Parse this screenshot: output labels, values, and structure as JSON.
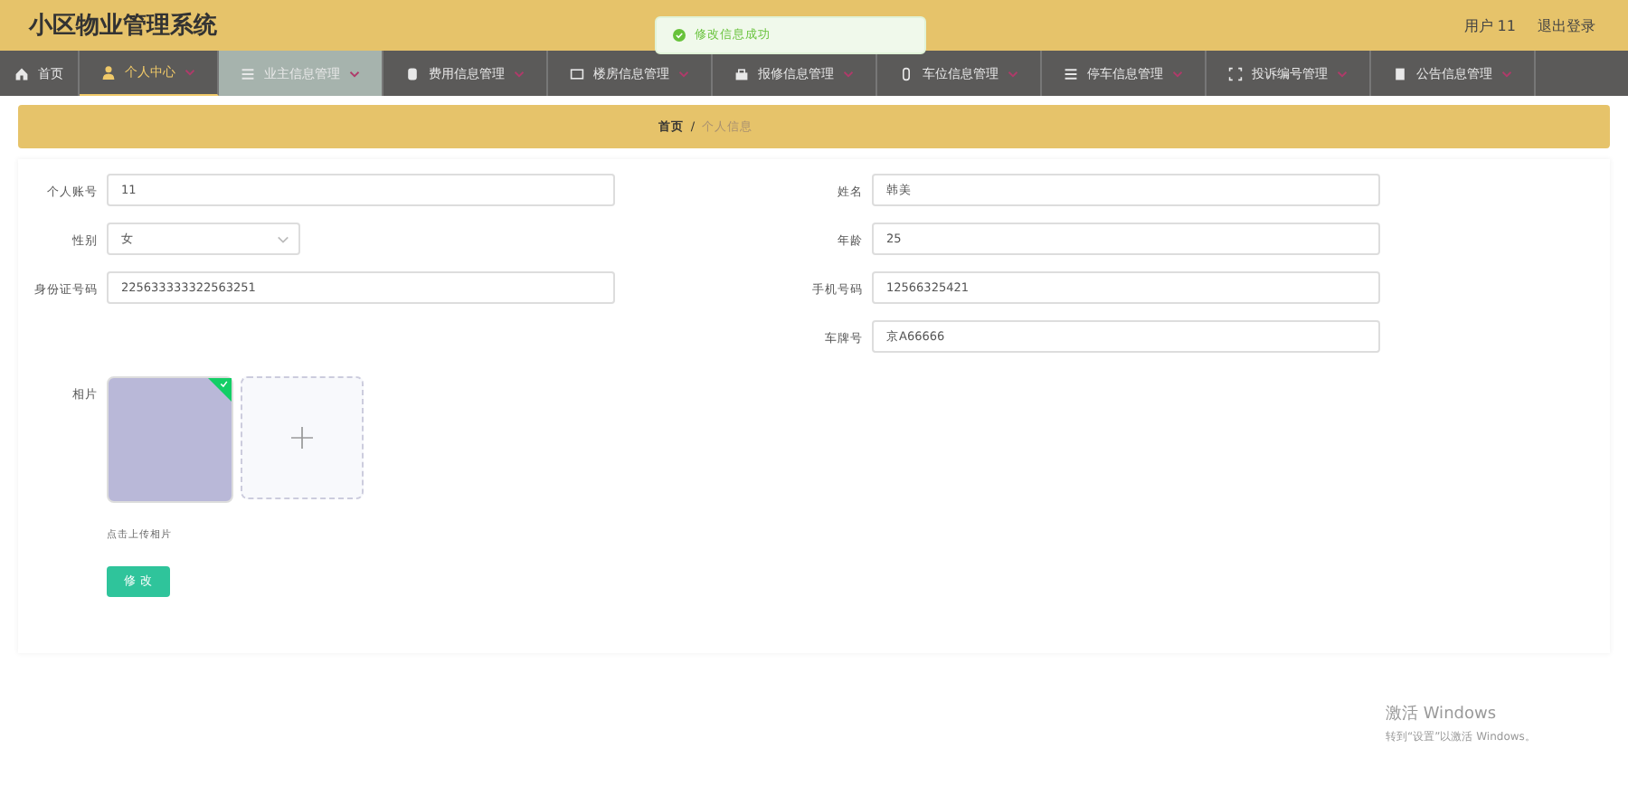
{
  "header": {
    "title": "小区物业管理系统",
    "user": "用户 11",
    "logout": "退出登录"
  },
  "toast": {
    "message": "修改信息成功"
  },
  "nav": [
    {
      "label": "首页",
      "selected": false,
      "hovered": false,
      "has_caret": false
    },
    {
      "label": "个人中心",
      "selected": true,
      "hovered": false,
      "has_caret": true
    },
    {
      "label": "业主信息管理",
      "selected": false,
      "hovered": true,
      "has_caret": true
    },
    {
      "label": "费用信息管理",
      "selected": false,
      "hovered": false,
      "has_caret": true
    },
    {
      "label": "楼房信息管理",
      "selected": false,
      "hovered": false,
      "has_caret": true
    },
    {
      "label": "报修信息管理",
      "selected": false,
      "hovered": false,
      "has_caret": true
    },
    {
      "label": "车位信息管理",
      "selected": false,
      "hovered": false,
      "has_caret": true
    },
    {
      "label": "停车信息管理",
      "selected": false,
      "hovered": false,
      "has_caret": true
    },
    {
      "label": "投诉编号管理",
      "selected": false,
      "hovered": false,
      "has_caret": true
    },
    {
      "label": "公告信息管理",
      "selected": false,
      "hovered": false,
      "has_caret": true
    }
  ],
  "breadcrumb": {
    "home": "首页",
    "separator": "/",
    "current": "个人信息"
  },
  "form": {
    "left": [
      {
        "kind": "input",
        "label": "个人账号",
        "value": "11"
      },
      {
        "kind": "select",
        "label": "性别",
        "value": "女"
      },
      {
        "kind": "input",
        "label": "身份证号码",
        "value": "225633333322563251"
      }
    ],
    "right": [
      {
        "kind": "input",
        "label": "姓名",
        "value": "韩美"
      },
      {
        "kind": "input",
        "label": "年龄",
        "value": "25"
      },
      {
        "kind": "input",
        "label": "手机号码",
        "value": "12566325421"
      },
      {
        "kind": "input",
        "label": "车牌号",
        "value": "京A66666"
      }
    ],
    "photo": {
      "label": "相片",
      "uploaded": true,
      "hint": "点击上传相片"
    },
    "submit": "修 改"
  },
  "activation": {
    "title": "激活 Windows",
    "subtitle": "转到“设置”以激活 Windows。"
  }
}
